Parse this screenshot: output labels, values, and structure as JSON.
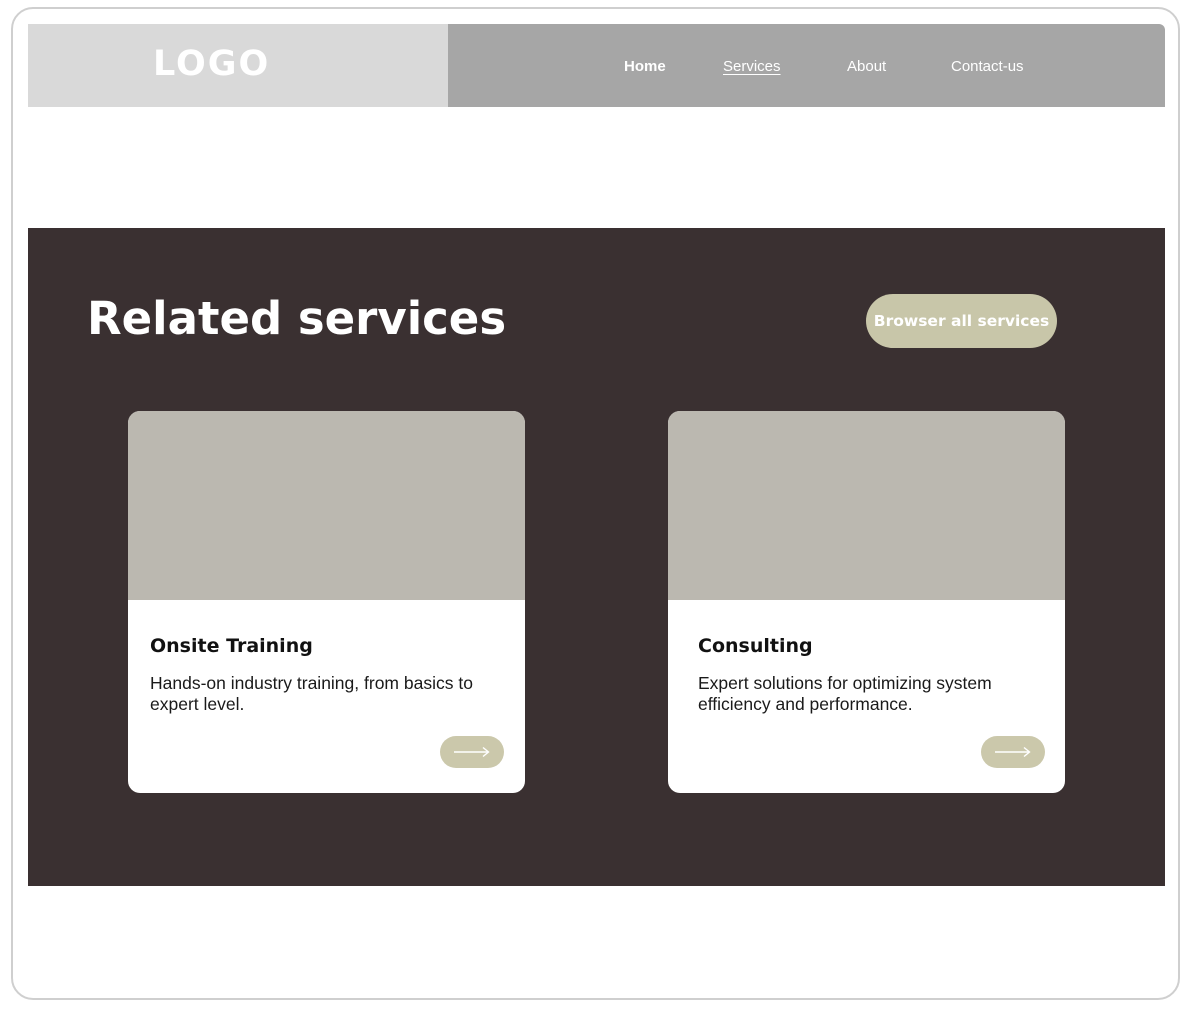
{
  "header": {
    "logo": "LOGO",
    "nav": [
      {
        "label": "Home",
        "active": true
      },
      {
        "label": "Services",
        "underlined": true
      },
      {
        "label": "About"
      },
      {
        "label": "Contact-us"
      }
    ]
  },
  "related": {
    "title": "Related services",
    "browse_label": "Browser all services",
    "cards": [
      {
        "title": "Onsite Training",
        "description": "Hands-on industry training, from basics to expert level.",
        "icon": "arrow-right-icon"
      },
      {
        "title": "Consulting",
        "description": "Expert solutions for optimizing system efficiency and performance.",
        "icon": "arrow-right-icon"
      }
    ]
  },
  "colors": {
    "header_logo_bg": "#d9d9d9",
    "header_nav_bg": "#a6a6a6",
    "section_bg": "#3a3031",
    "accent": "#c8c6a9",
    "card_image_placeholder": "#bbb8b0"
  }
}
